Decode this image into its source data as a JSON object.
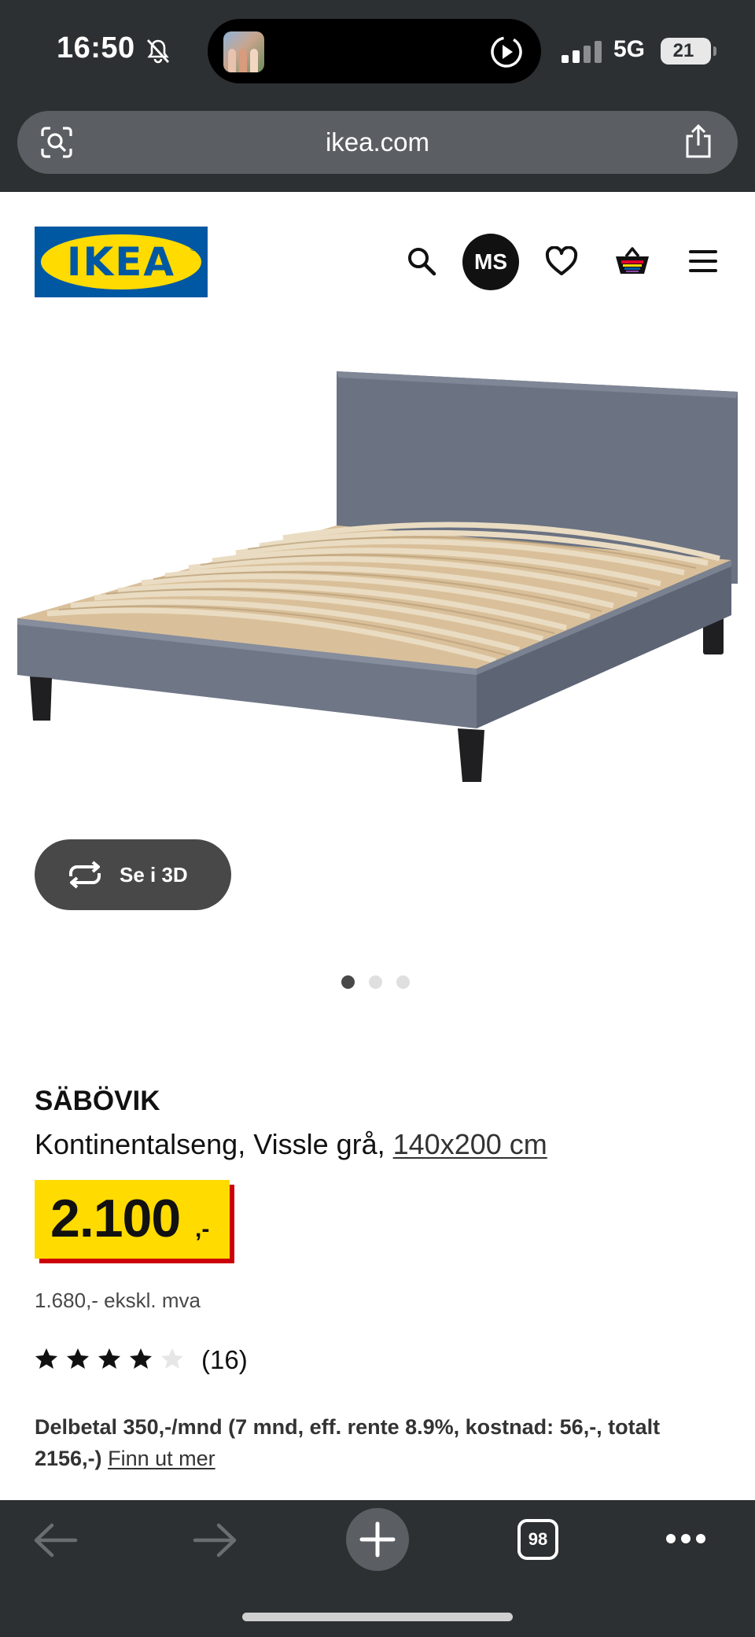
{
  "status_bar": {
    "time": "16:50",
    "network": "5G",
    "battery": "21"
  },
  "browser": {
    "url": "ikea.com",
    "open_tabs": "98"
  },
  "header": {
    "logo_text": "IKEA",
    "account_initials": "MS"
  },
  "product": {
    "view_3d_label": "Se i 3D",
    "image_count": 3,
    "active_image": 1,
    "name": "SÄBÖVIK",
    "description": "Kontinentalseng, Vissle grå,",
    "size_link": "140x200 cm",
    "price_main": "2.100",
    "price_suffix": ",-",
    "price_ex_vat": "1.680,- ekskl. mva",
    "rating": 4,
    "rating_max": 5,
    "review_count": "(16)",
    "installment_text": "Delbetal 350,-/mnd (7 mnd, eff. rente 8.9%, kostnad: 56,-, totalt 2156,-)",
    "installment_link": "Finn ut mer"
  },
  "colors": {
    "ikea_blue": "#0058a3",
    "ikea_yellow": "#ffdb00",
    "price_red": "#cc0008",
    "chrome_dark": "#2d3032"
  },
  "icons": [
    "bell-muted-icon",
    "play-icon",
    "signal-icon",
    "battery-icon",
    "visual-search-icon",
    "share-icon",
    "search-icon",
    "heart-icon",
    "cart-icon",
    "hamburger-menu-icon",
    "rotate-3d-icon",
    "star-icon",
    "back-arrow-icon",
    "forward-arrow-icon",
    "plus-icon",
    "tabs-icon",
    "more-icon"
  ]
}
